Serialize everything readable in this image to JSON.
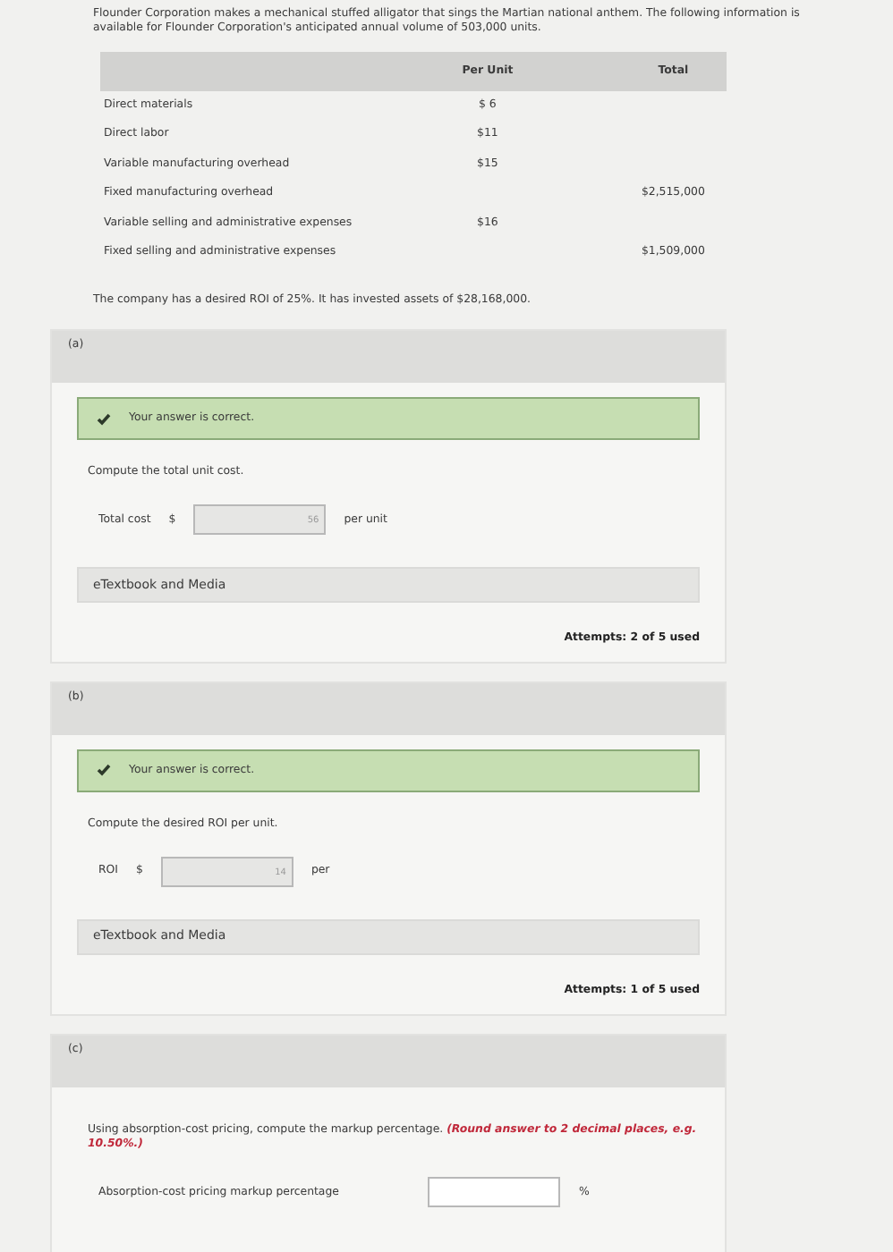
{
  "intro": "Flounder Corporation makes a mechanical stuffed alligator that sings the Martian national anthem. The following information is available for Flounder Corporation's anticipated annual volume of 503,000 units.",
  "table": {
    "columns": [
      "Per Unit",
      "Total"
    ],
    "rows": [
      {
        "label": "Direct materials",
        "per_unit": "$ 6"
      },
      {
        "label": "Direct labor",
        "per_unit": "$11"
      },
      {
        "label": "Variable manufacturing overhead",
        "per_unit": "$15"
      },
      {
        "label": "Fixed manufacturing overhead",
        "total": "$2,515,000"
      },
      {
        "label": "Variable selling and administrative expenses",
        "per_unit": "$16"
      },
      {
        "label": "Fixed selling and administrative expenses",
        "total": "$1,509,000"
      }
    ]
  },
  "roi_note": "The company has a desired ROI of 25%. It has invested assets of $28,168,000.",
  "parts": [
    {
      "label": "(a)",
      "feedback": "Your answer is correct.",
      "correct": true,
      "prompt": "Compute the total unit cost.",
      "field_label": "Total cost",
      "prefix": "$",
      "value": "56",
      "suffix": "per unit",
      "link": "eTextbook and Media",
      "attempts": "Attempts: 2 of 5 used"
    },
    {
      "label": "(b)",
      "feedback": "Your answer is correct.",
      "correct": true,
      "prompt": "Compute the desired ROI per unit.",
      "field_label": "ROI",
      "prefix": "$",
      "value": "14",
      "suffix": "per",
      "link": "eTextbook and Media",
      "attempts": "Attempts: 1 of 5 used"
    },
    {
      "label": "(c)",
      "prompt": "Using absorption-cost pricing, compute the markup percentage.",
      "note": "(Round answer to 2 decimal places, e.g. 10.50%.)",
      "field_label": "Absorption-cost pricing markup percentage",
      "suffix": "%"
    }
  ]
}
